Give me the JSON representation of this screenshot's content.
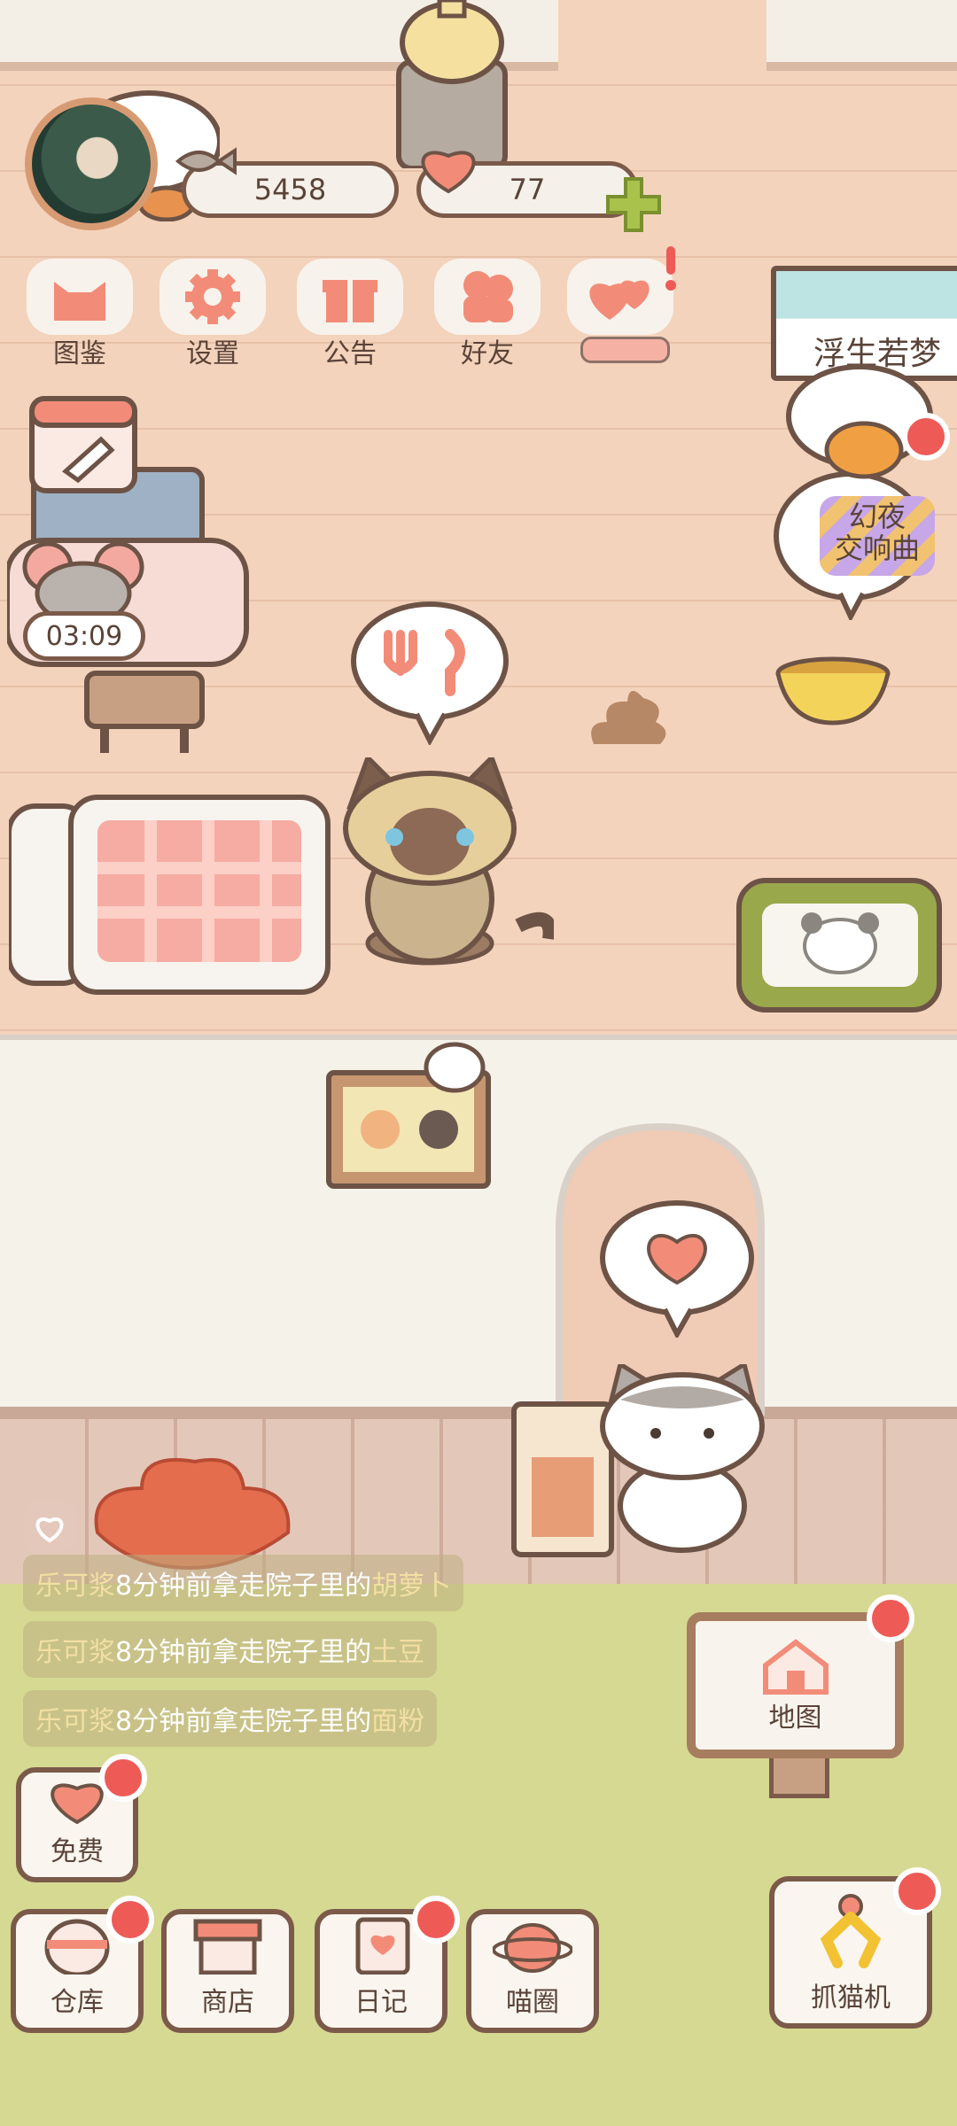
{
  "hud": {
    "coins": "5458",
    "hearts": "77"
  },
  "menu": [
    {
      "label": "图鉴",
      "icon": "cat-head-icon"
    },
    {
      "label": "设置",
      "icon": "gear-icon"
    },
    {
      "label": "公告",
      "icon": "gift-icon"
    },
    {
      "label": "好友",
      "icon": "friends-icon"
    },
    {
      "label": "",
      "icon": "event-hearts-icon"
    }
  ],
  "banners": {
    "float_dream": "浮生若梦",
    "night_symphony": "幻夜\n交响曲"
  },
  "timer": "03:09",
  "feed": [
    {
      "who": "乐可浆",
      "mid": "8分钟前拿走院子里的",
      "item": "胡萝卜"
    },
    {
      "who": "乐可浆",
      "mid": "8分钟前拿走院子里的",
      "item": "土豆"
    },
    {
      "who": "乐可浆",
      "mid": "8分钟前拿走院子里的",
      "item": "面粉"
    }
  ],
  "bottom": {
    "free": "免费",
    "storage": "仓库",
    "shop": "商店",
    "diary": "日记",
    "circle": "喵圈",
    "map": "地图",
    "claw": "抓猫机"
  },
  "colors": {
    "accent_red": "#ee5b57",
    "coral": "#f28c78",
    "outline": "#7b5a4a",
    "wall": "#f4d3bc",
    "yard": "#d6d991"
  }
}
